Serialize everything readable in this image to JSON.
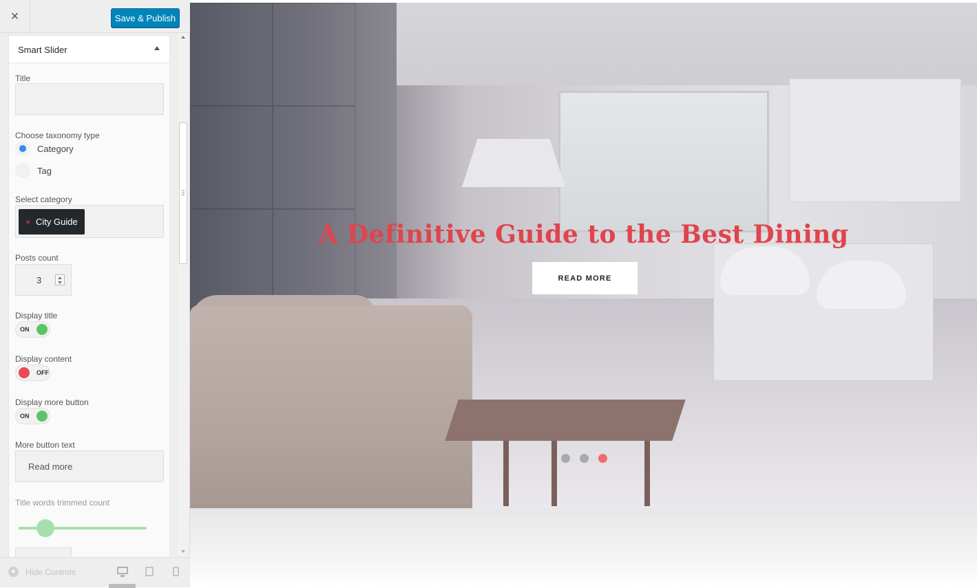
{
  "header": {
    "close_glyph": "×",
    "save_label": "Save & Publish"
  },
  "section": {
    "title": "Smart Slider"
  },
  "fields": {
    "title_label": "Title",
    "title_value": "",
    "taxonomy_label": "Choose taxonomy type",
    "taxonomy_options": [
      {
        "label": "Category",
        "checked": true
      },
      {
        "label": "Tag",
        "checked": false
      }
    ],
    "category_label": "Select category",
    "category_chip_remove": "×",
    "category_chip": "City Guide",
    "posts_count_label": "Posts count",
    "posts_count": "3",
    "display_title_label": "Display title",
    "display_title_state": "ON",
    "display_content_label": "Display content",
    "display_content_state": "OFF",
    "display_more_label": "Display more button",
    "display_more_state": "ON",
    "more_text_label": "More button text",
    "more_text_value": "Read more",
    "trim_label": "Title words trimmed count"
  },
  "footer": {
    "hide_controls": "Hide Controls",
    "devices": [
      "desktop-icon",
      "tablet-icon",
      "mobile-icon"
    ]
  },
  "preview": {
    "slide_title": "A Definitive Guide to the Best Dining",
    "button_label": "READ MORE",
    "dots_count": 3,
    "active_dot": 3
  },
  "colors": {
    "accent_blue": "#0085ba",
    "radio_blue": "#2d8cf0",
    "toggle_on": "#5cc466",
    "toggle_off": "#e94b55",
    "slide_title": "#e0444c",
    "active_dot": "#f06a70"
  }
}
